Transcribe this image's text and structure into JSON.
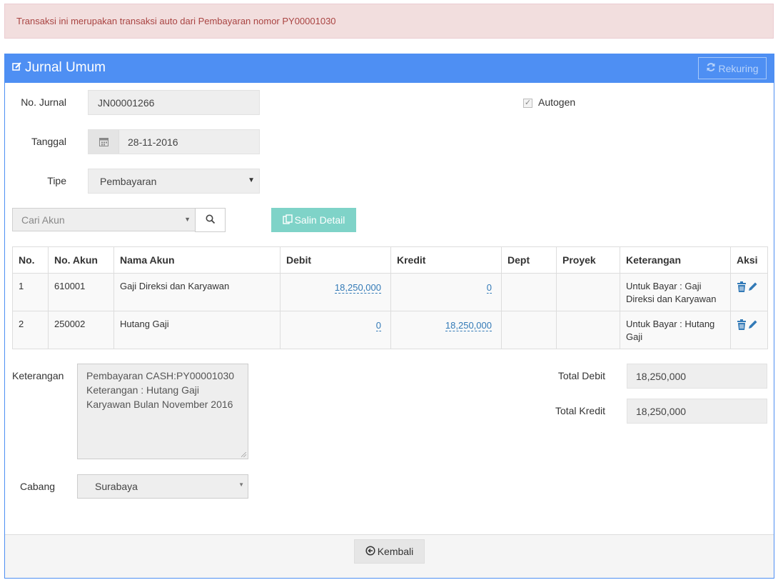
{
  "alert": {
    "text": "Transaksi ini merupakan transaksi auto dari Pembayaran nomor PY00001030"
  },
  "panel": {
    "title": "Jurnal Umum",
    "title_icon": "edit-icon",
    "rekuring_label": "Rekuring",
    "rekuring_icon": "refresh-icon"
  },
  "form": {
    "no_jurnal_label": "No. Jurnal",
    "no_jurnal_value": "JN00001266",
    "autogen_label": "Autogen",
    "autogen_checked": true,
    "tanggal_label": "Tanggal",
    "tanggal_value": "28-11-2016",
    "tipe_label": "Tipe",
    "tipe_value": "Pembayaran",
    "cari_akun_placeholder": "Cari Akun",
    "salin_detail_label": "Salin Detail"
  },
  "table": {
    "headers": [
      "No.",
      "No. Akun",
      "Nama Akun",
      "Debit",
      "Kredit",
      "Dept",
      "Proyek",
      "Keterangan",
      "Aksi"
    ],
    "rows": [
      {
        "no": "1",
        "no_akun": "610001",
        "nama_akun": "Gaji Direksi dan Karyawan",
        "debit": "18,250,000",
        "kredit": "0",
        "dept": "",
        "proyek": "",
        "keterangan": "Untuk Bayar : Gaji Direksi dan Karyawan"
      },
      {
        "no": "2",
        "no_akun": "250002",
        "nama_akun": "Hutang Gaji",
        "debit": "0",
        "kredit": "18,250,000",
        "dept": "",
        "proyek": "",
        "keterangan": "Untuk Bayar : Hutang Gaji"
      }
    ]
  },
  "summary": {
    "keterangan_label": "Keterangan",
    "keterangan_value": "Pembayaran CASH:PY00001030\nKeterangan : Hutang Gaji Karyawan Bulan November 2016",
    "total_debit_label": "Total Debit",
    "total_debit_value": "18,250,000",
    "total_kredit_label": "Total Kredit",
    "total_kredit_value": "18,250,000",
    "cabang_label": "Cabang",
    "cabang_value": "Surabaya"
  },
  "footer": {
    "kembali_label": "Kembali"
  },
  "colors": {
    "primary": "#4e8ff3",
    "alert_bg": "#f2dede",
    "alert_text": "#a94442",
    "teal_button": "#7fd3c8",
    "link": "#337ab7"
  }
}
